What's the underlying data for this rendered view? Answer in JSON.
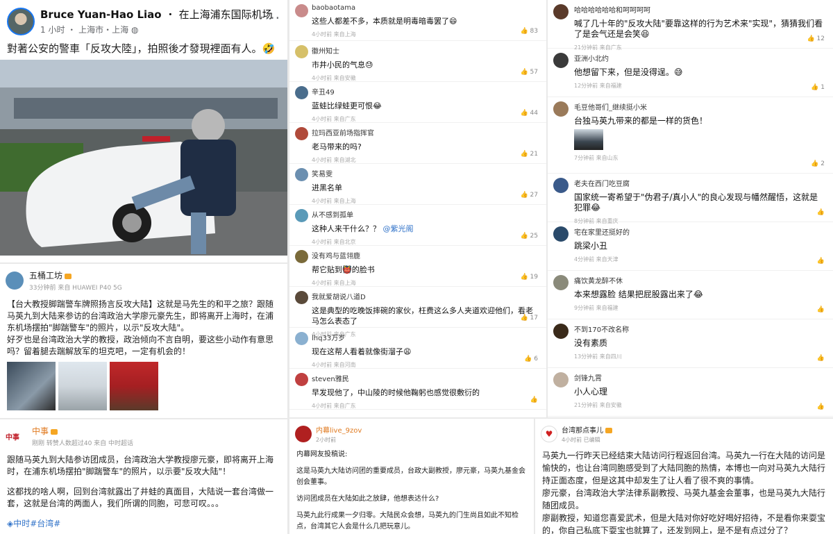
{
  "facebook_post": {
    "author": "Bruce Yuan-Hao Liao",
    "location": "在上海浦东国际机场",
    "time": "1 小时",
    "place": "上海市・上海",
    "more": "···",
    "text": "對著公安的警車「反攻大陸」，拍照後才發現裡面有人。🤣"
  },
  "weibo_post": {
    "author": "五桶工坊",
    "meta": "33分钟前 来自 HUAWEI P40 5G",
    "paragraph1": "【台大教授脚踹警车牌照扬言反攻大陆】这就是马先生的和平之旅？跟随马英九到大陆来参访的台湾政治大学廖元豪先生，即将离开上海时，在浦东机场摆拍\"脚踹警车\"的照片，以示\"反攻大陆\"。",
    "paragraph2": "好歹也是台湾政治大学的教授，政治倾向不言自明，要这些小动作有意思吗？留着腿去踹解放军的坦克吧，一定有机会的！"
  },
  "zhongshi_post": {
    "logo": "中事",
    "author": "中事",
    "meta": "刚刚 转赞人数超过40 来自 中时超话",
    "paragraph1": "跟随马英九到大陆参访团成员，台湾政治大学教授廖元豪，即将离开上海时，在浦东机场摆拍\"脚踹警车\"的照片，以示要\"反攻大陆\"！",
    "paragraph2": "这都找的啥人啊，回到台湾就露出了井蛙的真面目，大陆说一套台湾做一套，这就是台湾的两面人，我们所谓的同胞，可悲可叹。。。",
    "tag": "中时#台湾#"
  },
  "comments_left": [
    {
      "name": "baobaotama",
      "text": "这些人都差不多，本质就是明毒暗毒罢了😄",
      "time": "4小时前 来自上海",
      "likes": "83",
      "color": "#c98b8b"
    },
    {
      "name": "徽州知士",
      "text": "市井小民的气息😓",
      "time": "4小时前 来自安徽",
      "likes": "57",
      "color": "#d6c069"
    },
    {
      "name": "辛丑49",
      "text": "蓝蛙比绿蛙更可恨😂",
      "time": "4小时前 来自广东",
      "likes": "44",
      "color": "#4a6d8c"
    },
    {
      "name": "拉玛西亚前场指挥官",
      "text": "老马带来的吗?",
      "time": "4小时前 来自湖北",
      "likes": "21",
      "color": "#b04a3a"
    },
    {
      "name": "笑易雯",
      "text": "进黑名单",
      "time": "4小时前 来自上海",
      "likes": "27",
      "color": "#6b8fb0"
    },
    {
      "name": "从不感到孤单",
      "text": "这种人来干什么？？ @紫光阁",
      "time": "4小时前 来自北京",
      "likes": "25",
      "color": "#5a9ab8"
    },
    {
      "name": "没有鸡与蓝翎鹿",
      "text": "帮它贴到👹的脸书",
      "time": "4小时前 来自上海",
      "likes": "19",
      "color": "#7a6a3a"
    },
    {
      "name": "我就爱胡说八道D",
      "text": "这是典型的吃晚饭摔碗的家伙，枉费这么多人夹道欢迎他们，看老马怎么表态了",
      "time": "4小时前 来自广东",
      "likes": "17",
      "color": "#5a4a3a"
    },
    {
      "name": "lhq33万岁",
      "text": "现在这帮人看着就像街溜子😩",
      "time": "4小时前 来自河南",
      "likes": "6",
      "color": "#8ab0d0"
    },
    {
      "name": "steven雅民",
      "text": "早发现他了，中山陵的时候他鞠躬也感觉很敷衍的",
      "time": "4小时前 来自广东",
      "likes": "",
      "color": "#c04040"
    }
  ],
  "comments_right": [
    {
      "name": "哈哈哈哈哈哈和呵呵呵呵",
      "text": "喊了几十年的\"反攻大陆\"要靠这样的行为艺术来\"实现\"，猜猜我们看了是会气还是会笑😆",
      "time": "21分钟前 来自广东",
      "likes": "12",
      "color": "#5a3a2a"
    },
    {
      "name": "亚洲小北约",
      "text": "他想留下来，但是没得逞。😅",
      "time": "12分钟前 来自福建",
      "likes": "1",
      "color": "#3a3a3a"
    },
    {
      "name": "毛豆他哥们_继续挺小米",
      "text": "台独马英九带来的都是一样的货色！",
      "time": "7分钟前 来自山东",
      "likes": "2",
      "color": "#9a7a5a"
    },
    {
      "name": "老夫在西门吃豆腐",
      "text": "国家统一寄希望于\"伪君子/真小人\"的良心发现与幡然醒悟，这就是犯罪😂",
      "time": "8分钟前 来自重庆",
      "likes": "",
      "color": "#3a5a8a"
    },
    {
      "name": "宅在家里还挺好的",
      "text": "跳梁小丑",
      "time": "4分钟前 来自天津",
      "likes": "",
      "color": "#2a4a6a"
    },
    {
      "name": "痛饮黄龙醉不休",
      "text": "本来想露脸 结果把屁股露出来了😂",
      "time": "9分钟前 来自福建",
      "likes": "",
      "color": "#8a8a7a"
    },
    {
      "name": "不到170不改名称",
      "text": "没有素质",
      "time": "13分钟前 来自四川",
      "likes": "",
      "color": "#3a2a1a"
    },
    {
      "name": "剑锋九霄",
      "text": "小人心理",
      "time": "21分钟前 来自安徽",
      "likes": "",
      "color": "#c0b0a0"
    }
  ],
  "netizen_post": {
    "author": "内幕live_9zov",
    "time": "2小时前",
    "heading": "内幕网友投稿说:",
    "p1": "这是马英九大陆访问团的重要成员，台政大副教授，廖元豪，马英九基金会创会董事。",
    "p2": "访问团成员在大陆如此之放肆，他想表达什么?",
    "p3": "马英九此行成果一夕归零。大陆民众会想，马英九的门生尚且如此不知检点，台湾其它人会是什么几把玩意儿。"
  },
  "taiwan_post": {
    "author": "台湾那点事儿",
    "meta": "4小时前 已编辑",
    "p1": "马英九一行昨天已经结束大陆访问行程返回台湾。马英九一行在大陆的访问是愉快的，也让台湾同胞感受到了大陆同胞的热情，本博也一向对马英九大陆行持正面态度，但是这其中却发生了让人看了很不爽的事情。",
    "p2": "廖元豪，台湾政治大学法律系副教授、马英九基金会董事，也是马英九大陆行随团成员。",
    "p3": "廖副教授，知道您喜爱武术，但是大陆对你好吃好喝好招待，不是看你来耍宝的，你自己私底下耍宝也就算了，还发到网上，是不是有点过分了？"
  }
}
